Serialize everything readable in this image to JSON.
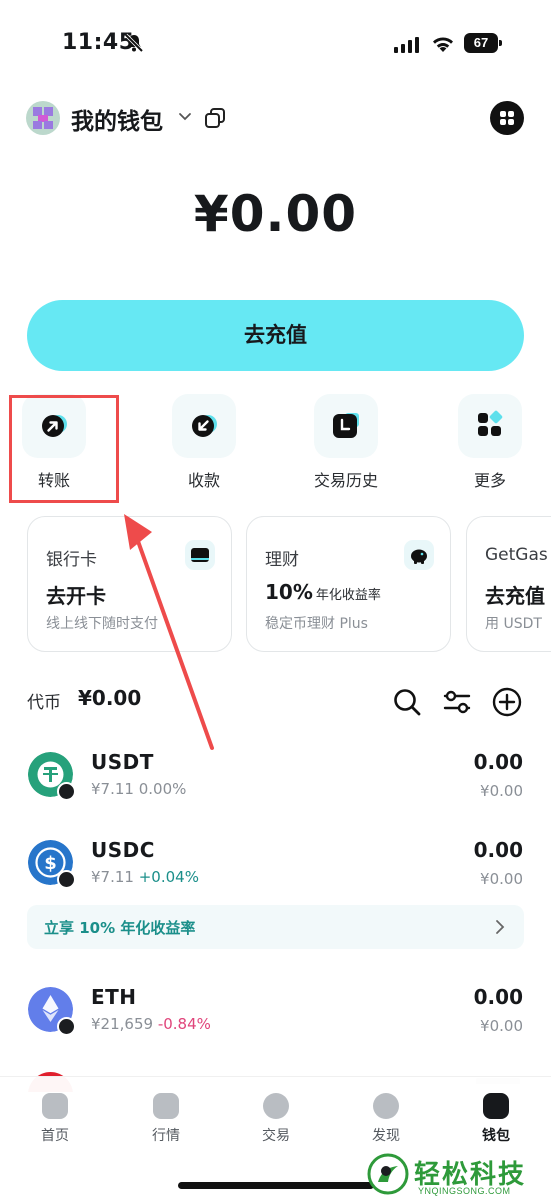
{
  "status_bar": {
    "time": "11:45",
    "battery": "67"
  },
  "header": {
    "wallet_name": "我的钱包"
  },
  "balance": "¥0.00",
  "topup_button": "去充值",
  "actions": [
    {
      "label": "转账",
      "icon": "arrow-up-right-icon"
    },
    {
      "label": "收款",
      "icon": "arrow-down-left-icon"
    },
    {
      "label": "交易历史",
      "icon": "clock-icon"
    },
    {
      "label": "更多",
      "icon": "grid-more-icon"
    }
  ],
  "cards": [
    {
      "title": "银行卡",
      "main": "去开卡",
      "main_suffix": "",
      "sub": "线上线下随时支付"
    },
    {
      "title": "理财",
      "main": "10%",
      "main_suffix": "年化收益率",
      "sub": "稳定币理财 Plus"
    },
    {
      "title": "GetGas",
      "main": "去充值",
      "main_suffix": "",
      "sub": "用 USDT"
    }
  ],
  "tokens_section": {
    "label": "代币",
    "total": "¥0.00"
  },
  "tokens": [
    {
      "symbol": "USDT",
      "price": "¥7.11",
      "change": "0.00%",
      "amount": "0.00",
      "value": "¥0.00"
    },
    {
      "symbol": "USDC",
      "price": "¥7.11",
      "change": "+0.04%",
      "amount": "0.00",
      "value": "¥0.00"
    },
    {
      "symbol": "ETH",
      "price": "¥21,659",
      "change": "-0.84%",
      "amount": "0.00",
      "value": "¥0.00"
    }
  ],
  "promo": {
    "text": "立享 10% 年化收益率"
  },
  "bottom_nav": [
    {
      "label": "首页",
      "active": false
    },
    {
      "label": "行情",
      "active": false
    },
    {
      "label": "交易",
      "active": false
    },
    {
      "label": "发现",
      "active": false
    },
    {
      "label": "钱包",
      "active": true
    }
  ],
  "watermark": {
    "name": "轻松科技",
    "domain": "YNQINGSONG.COM"
  },
  "colors": {
    "accent": "#66e8f3",
    "up": "#1b8f8a",
    "down": "#e0457b",
    "annotation": "#ee4b4b"
  }
}
